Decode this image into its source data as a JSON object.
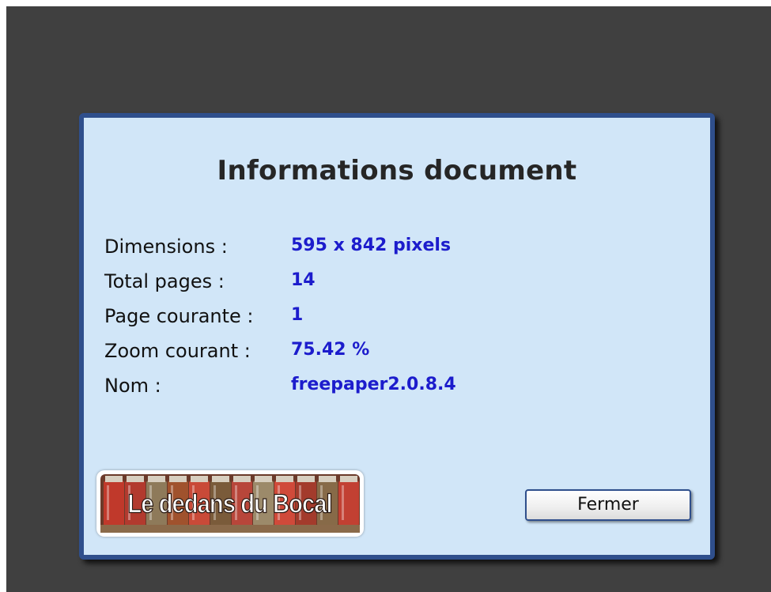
{
  "dialog": {
    "title": "Informations document",
    "rows": [
      {
        "label": "Dimensions :",
        "value": "595 x 842 pixels"
      },
      {
        "label": "Total pages :",
        "value": "14"
      },
      {
        "label": "Page courante :",
        "value": "1"
      },
      {
        "label": "Zoom courant :",
        "value": "75.42 %"
      },
      {
        "label": "Nom :",
        "value": "freepaper2.0.8.4"
      }
    ],
    "logo_text": "Le dedans du Bocal",
    "close_label": "Fermer"
  },
  "colors": {
    "dialog_background": "#d1e6f8",
    "dialog_border": "#2f4f8c",
    "value_text": "#1c1ccc",
    "backdrop": "#404040"
  }
}
